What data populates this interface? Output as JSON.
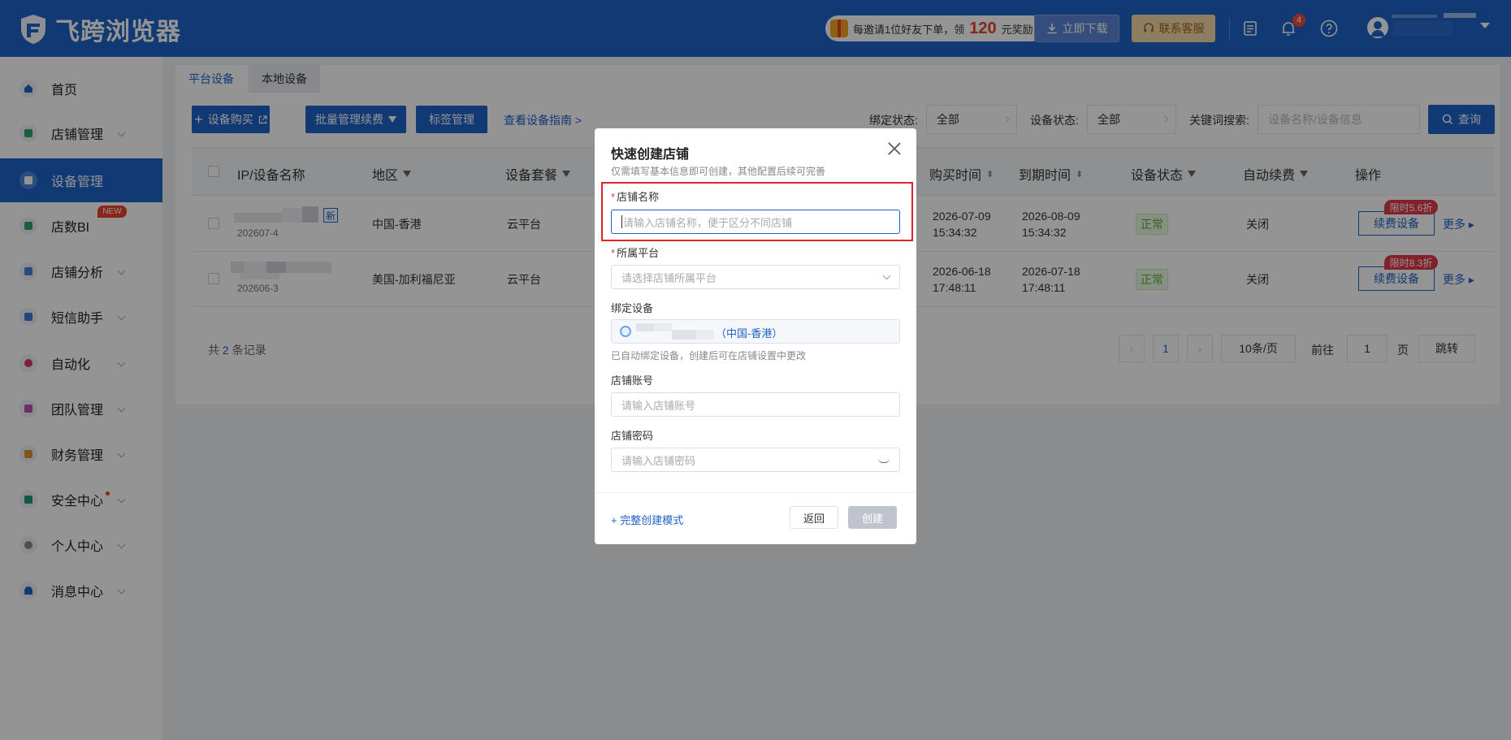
{
  "header": {
    "logo_text": "飞跨浏览器",
    "promo_prefix": "每邀请1位好友下单，领",
    "promo_amount": "120",
    "promo_suffix": "元奖励",
    "download_label": "立即下载",
    "service_label": "联系客服",
    "notification_count": "4",
    "colors": {
      "brand": "#1e62c8"
    }
  },
  "sidebar": {
    "items": [
      {
        "label": "首页",
        "icon": "home-icon"
      },
      {
        "label": "店铺管理",
        "icon": "store-icon"
      },
      {
        "label": "设备管理",
        "icon": "device-icon"
      },
      {
        "label": "店数BI",
        "icon": "bi-icon"
      },
      {
        "label": "店铺分析",
        "icon": "analysis-icon"
      },
      {
        "label": "短信助手",
        "icon": "sms-icon"
      },
      {
        "label": "自动化",
        "icon": "robot-icon"
      },
      {
        "label": "团队管理",
        "icon": "team-icon"
      },
      {
        "label": "财务管理",
        "icon": "wallet-icon"
      },
      {
        "label": "安全中心",
        "icon": "shield-icon"
      },
      {
        "label": "个人中心",
        "icon": "user-icon"
      },
      {
        "label": "消息中心",
        "icon": "bell-icon"
      }
    ],
    "new_badge": "NEW"
  },
  "tabs": [
    "平台设备",
    "本地设备"
  ],
  "toolbar": {
    "buy_label": "设备购买",
    "batch_label": "批量管理续费",
    "tag_label": "标签管理",
    "guide_label": "查看设备指南 >",
    "bind_status_label": "绑定状态:",
    "bind_status_value": "全部",
    "device_status_label": "设备状态:",
    "device_status_value": "全部",
    "keyword_label": "关键词搜索:",
    "keyword_placeholder": "设备名称/设备信息",
    "query_label": "查询"
  },
  "table": {
    "headers": {
      "name": "IP/设备名称",
      "region": "地区",
      "plan": "设备套餐",
      "buy_time": "购买时间",
      "expire_time": "到期时间",
      "status": "设备状态",
      "auto_renew": "自动续费",
      "ops": "操作"
    },
    "rows": [
      {
        "id": "202607-4",
        "new": "新",
        "region": "中国-香港",
        "plan": "云平台",
        "buy_date": "2026-07-09",
        "buy_clock": "15:34:32",
        "exp_date": "2026-08-09",
        "exp_clock": "15:34:32",
        "status": "正常",
        "auto": "关闭",
        "renew": "续费设备",
        "discount": "限时5.6折",
        "more": "更多"
      },
      {
        "id": "202606-3",
        "region": "美国-加利福尼亚",
        "plan": "云平台",
        "buy_date": "2026-06-18",
        "buy_clock": "17:48:11",
        "exp_date": "2026-07-18",
        "exp_clock": "17:48:11",
        "status": "正常",
        "auto": "关闭",
        "renew": "续费设备",
        "discount": "限时8.3折",
        "more": "更多"
      }
    ]
  },
  "pagination": {
    "total_prefix": "共",
    "total_count": "2",
    "total_suffix": "条记录",
    "current_page": "1",
    "page_size": "10条/页",
    "goto_label": "前往",
    "goto_value": "1",
    "page_unit": "页",
    "jump_label": "跳转"
  },
  "modal": {
    "title": "快速创建店铺",
    "subtitle": "仅需填写基本信息即可创建，其他配置后续可完善",
    "required_mark": "*",
    "store_name_label": "店铺名称",
    "store_name_placeholder": "请输入店铺名称，便于区分不同店铺",
    "platform_label": "所属平台",
    "platform_placeholder": "请选择店铺所属平台",
    "device_label": "绑定设备",
    "device_region": "（中国-香港）",
    "device_hint": "已自动绑定设备，创建后可在店铺设置中更改",
    "account_label": "店铺账号",
    "account_placeholder": "请输入店铺账号",
    "password_label": "店铺密码",
    "password_placeholder": "请输入店铺密码",
    "full_mode_label": "+ 完整创建模式",
    "back_label": "返回",
    "create_label": "创建"
  }
}
